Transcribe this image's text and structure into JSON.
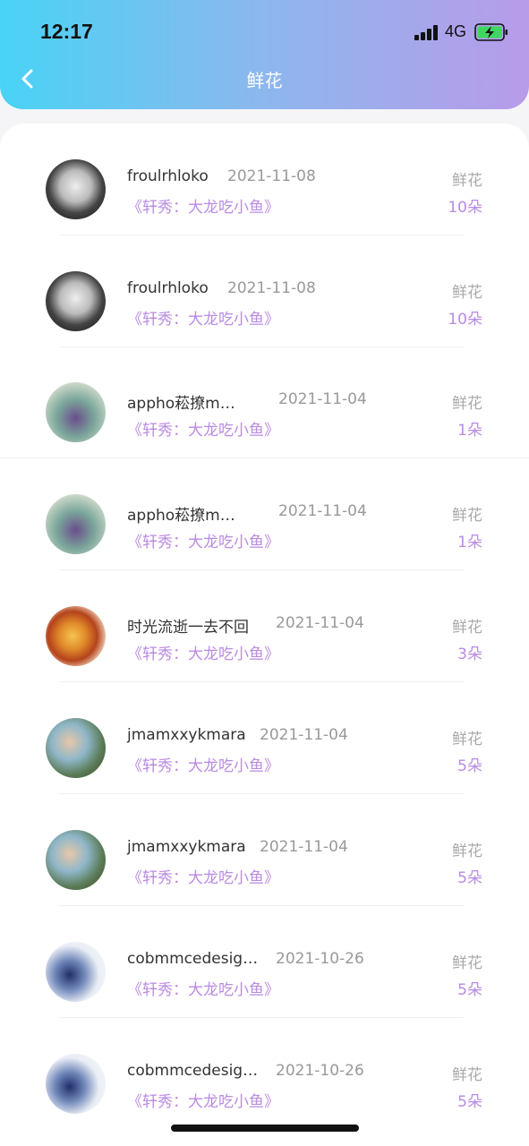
{
  "status": {
    "time": "12:17",
    "network": "4G"
  },
  "header": {
    "title": "鲜花"
  },
  "records": [
    {
      "name": "froulrhloko",
      "date": "2021-11-08",
      "topic": "《轩秀：大龙吃小鱼》",
      "type": "鲜花",
      "count": "10朵"
    },
    {
      "name": "froulrhloko",
      "date": "2021-11-08",
      "topic": "《轩秀：大龙吃小鱼》",
      "type": "鲜花",
      "count": "10朵"
    },
    {
      "name": "appho菘撩m…",
      "date": "2021-11-04",
      "topic": "《轩秀：大龙吃小鱼》",
      "type": "鲜花",
      "count": "1朵"
    },
    {
      "name": "appho菘撩m…",
      "date": "2021-11-04",
      "topic": "《轩秀：大龙吃小鱼》",
      "type": "鲜花",
      "count": "1朵"
    },
    {
      "name": "时光流逝一去不回",
      "date": "2021-11-04",
      "topic": "《轩秀：大龙吃小鱼》",
      "type": "鲜花",
      "count": "3朵"
    },
    {
      "name": "jmamxxykmara",
      "date": "2021-11-04",
      "topic": "《轩秀：大龙吃小鱼》",
      "type": "鲜花",
      "count": "5朵"
    },
    {
      "name": "jmamxxykmara",
      "date": "2021-11-04",
      "topic": "《轩秀：大龙吃小鱼》",
      "type": "鲜花",
      "count": "5朵"
    },
    {
      "name": "cobmmcedesig…",
      "date": "2021-10-26",
      "topic": "《轩秀：大龙吃小鱼》",
      "type": "鲜花",
      "count": "5朵"
    },
    {
      "name": "cobmmcedesig…",
      "date": "2021-10-26",
      "topic": "《轩秀：大龙吃小鱼》",
      "type": "鲜花",
      "count": "5朵"
    }
  ]
}
